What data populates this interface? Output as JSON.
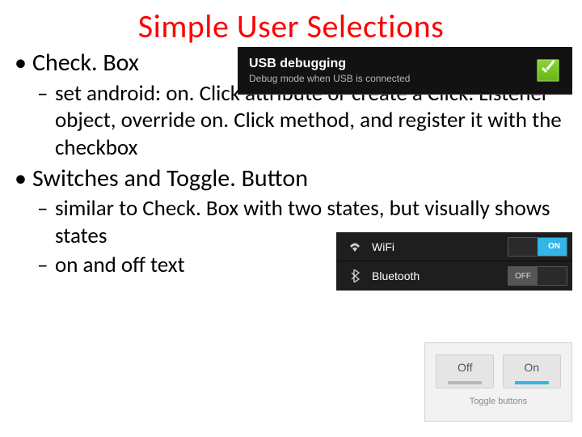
{
  "title": "Simple User Selections",
  "bullets": {
    "checkbox_label": "Check. Box",
    "checkbox_sub": "set android: on. Click attribute or create a Click. Listener object, override on. Click method, and register it with the checkbox",
    "switches_label": "Switches and Toggle. Button",
    "switches_sub1": "similar to Check. Box with two states, but visually shows states",
    "switches_sub2": "on and off text"
  },
  "usb": {
    "title": "USB debugging",
    "subtitle": "Debug mode when USB is connected",
    "checked": true
  },
  "quicksettings": {
    "wifi": {
      "label": "WiFi",
      "state": "ON"
    },
    "bluetooth": {
      "label": "Bluetooth",
      "state": "OFF"
    }
  },
  "togglebuttons": {
    "off_label": "Off",
    "on_label": "On",
    "caption": "Toggle buttons"
  }
}
